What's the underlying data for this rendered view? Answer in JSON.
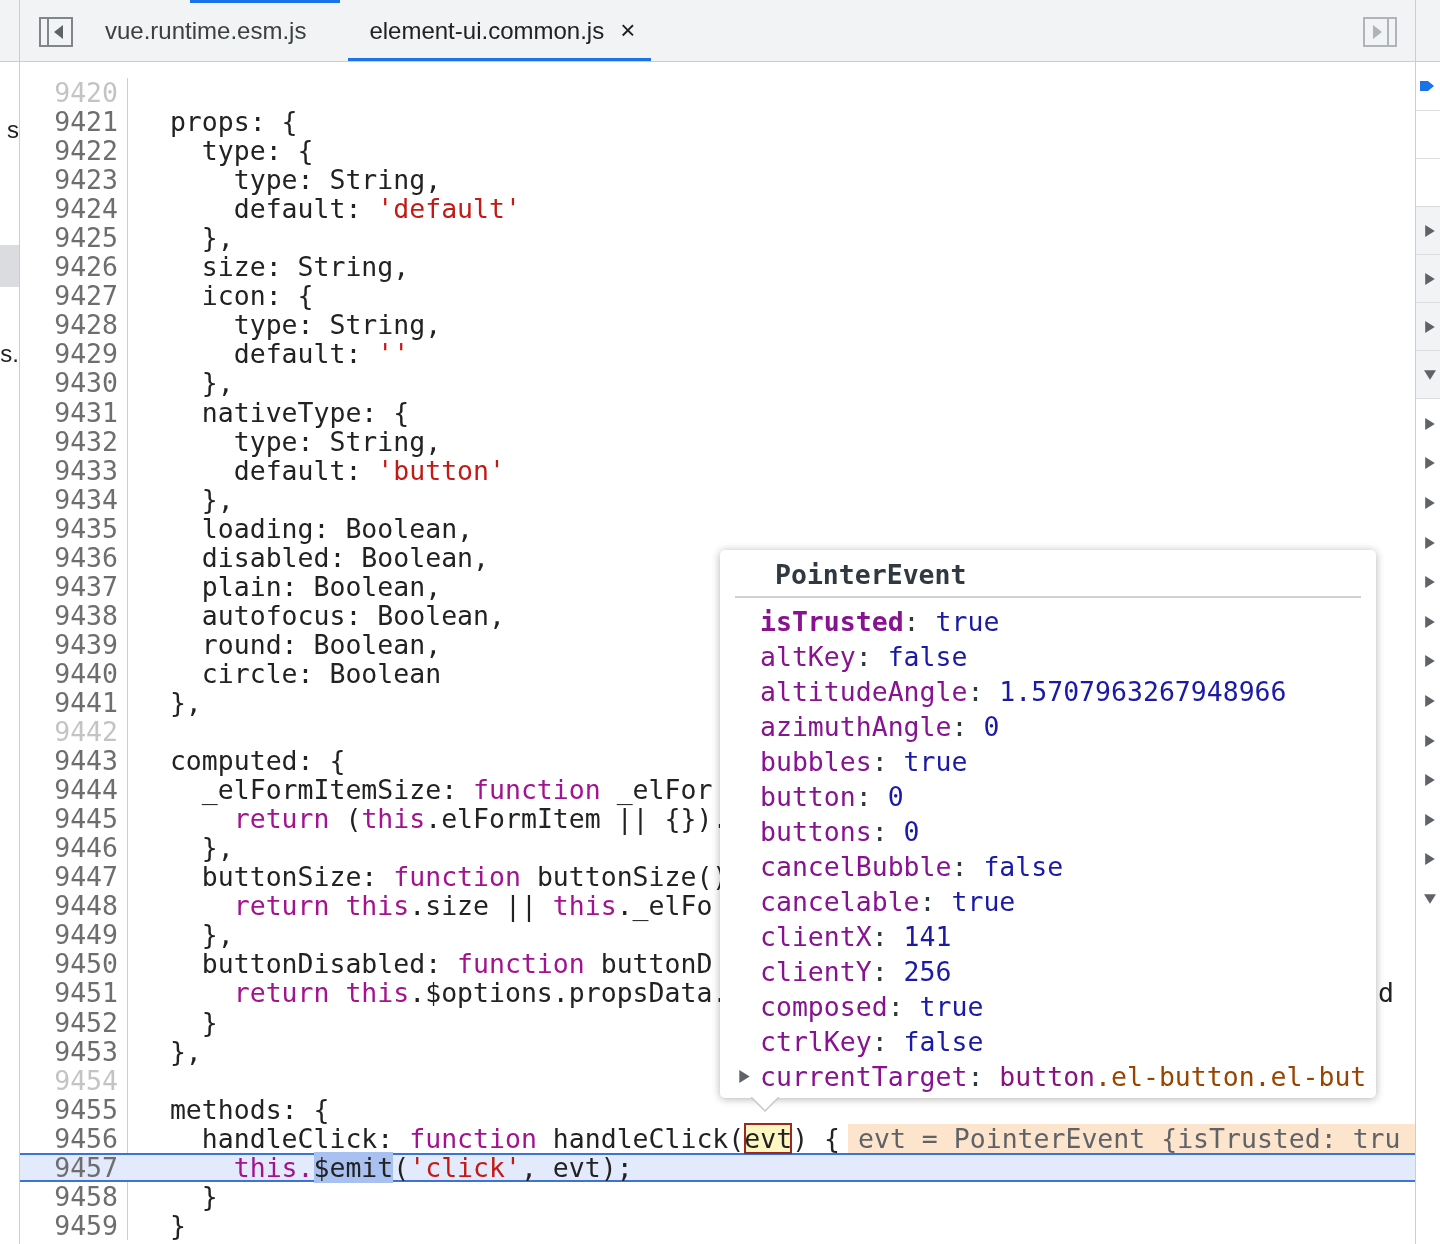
{
  "left_panel": {
    "items": [
      {
        "text": "s",
        "selected": false
      },
      {
        "selected": true
      },
      {
        "text": "s.",
        "selected": false
      }
    ]
  },
  "tabs": [
    {
      "label": "vue.runtime.esm.js",
      "selected": false
    },
    {
      "label": "element-ui.common.js",
      "selected": true,
      "close": "×"
    }
  ],
  "editor": {
    "lines": [
      {
        "number": "9420",
        "muted": true,
        "current": false
      },
      {
        "number": "9421",
        "muted": false,
        "current": false,
        "tokens": [
          {
            "text": "  props: {",
            "kind": "plain"
          }
        ]
      },
      {
        "number": "9422",
        "muted": false,
        "current": false,
        "tokens": [
          {
            "text": "    type: {",
            "kind": "plain"
          }
        ]
      },
      {
        "number": "9423",
        "muted": false,
        "current": false,
        "tokens": [
          {
            "text": "      type: String,",
            "kind": "plain"
          }
        ]
      },
      {
        "number": "9424",
        "muted": false,
        "current": false,
        "tokens": [
          {
            "text": "      default: ",
            "kind": "plain"
          },
          {
            "text": "'default'",
            "kind": "string"
          }
        ]
      },
      {
        "number": "9425",
        "muted": false,
        "current": false,
        "tokens": [
          {
            "text": "    },",
            "kind": "plain"
          }
        ]
      },
      {
        "number": "9426",
        "muted": false,
        "current": false,
        "tokens": [
          {
            "text": "    size: String,",
            "kind": "plain"
          }
        ]
      },
      {
        "number": "9427",
        "muted": false,
        "current": false,
        "tokens": [
          {
            "text": "    icon: {",
            "kind": "plain"
          }
        ]
      },
      {
        "number": "9428",
        "muted": false,
        "current": false,
        "tokens": [
          {
            "text": "      type: String,",
            "kind": "plain"
          }
        ]
      },
      {
        "number": "9429",
        "muted": false,
        "current": false,
        "tokens": [
          {
            "text": "      default: ",
            "kind": "plain"
          },
          {
            "text": "''",
            "kind": "string"
          }
        ]
      },
      {
        "number": "9430",
        "muted": false,
        "current": false,
        "tokens": [
          {
            "text": "    },",
            "kind": "plain"
          }
        ]
      },
      {
        "number": "9431",
        "muted": false,
        "current": false,
        "tokens": [
          {
            "text": "    nativeType: {",
            "kind": "plain"
          }
        ]
      },
      {
        "number": "9432",
        "muted": false,
        "current": false,
        "tokens": [
          {
            "text": "      type: String,",
            "kind": "plain"
          }
        ]
      },
      {
        "number": "9433",
        "muted": false,
        "current": false,
        "tokens": [
          {
            "text": "      default: ",
            "kind": "plain"
          },
          {
            "text": "'button'",
            "kind": "string"
          }
        ]
      },
      {
        "number": "9434",
        "muted": false,
        "current": false,
        "tokens": [
          {
            "text": "    },",
            "kind": "plain"
          }
        ]
      },
      {
        "number": "9435",
        "muted": false,
        "current": false,
        "tokens": [
          {
            "text": "    loading: Boolean,",
            "kind": "plain"
          }
        ]
      },
      {
        "number": "9436",
        "muted": false,
        "current": false,
        "tokens": [
          {
            "text": "    disabled: Boolean,",
            "kind": "plain"
          }
        ]
      },
      {
        "number": "9437",
        "muted": false,
        "current": false,
        "tokens": [
          {
            "text": "    plain: Boolean,",
            "kind": "plain"
          }
        ]
      },
      {
        "number": "9438",
        "muted": false,
        "current": false,
        "tokens": [
          {
            "text": "    autofocus: Boolean,",
            "kind": "plain"
          }
        ]
      },
      {
        "number": "9439",
        "muted": false,
        "current": false,
        "tokens": [
          {
            "text": "    round: Boolean,",
            "kind": "plain"
          }
        ]
      },
      {
        "number": "9440",
        "muted": false,
        "current": false,
        "tokens": [
          {
            "text": "    circle: Boolean",
            "kind": "plain"
          }
        ]
      },
      {
        "number": "9441",
        "muted": false,
        "current": false,
        "tokens": [
          {
            "text": "  },",
            "kind": "plain"
          }
        ]
      },
      {
        "number": "9442",
        "muted": true,
        "current": false
      },
      {
        "number": "9443",
        "muted": false,
        "current": false,
        "tokens": [
          {
            "text": "  computed: {",
            "kind": "plain"
          }
        ]
      },
      {
        "number": "9444",
        "muted": false,
        "current": false,
        "tokens": [
          {
            "text": "    _elFormItemSize: ",
            "kind": "plain"
          },
          {
            "text": "function",
            "kind": "keyword"
          },
          {
            "text": " _elFor",
            "kind": "plain"
          }
        ]
      },
      {
        "number": "9445",
        "muted": false,
        "current": false,
        "tokens": [
          {
            "text": "      return",
            "kind": "keyword"
          },
          {
            "text": " (",
            "kind": "plain"
          },
          {
            "text": "this",
            "kind": "keyword"
          },
          {
            "text": ".elFormItem || {}).",
            "kind": "plain"
          }
        ]
      },
      {
        "number": "9446",
        "muted": false,
        "current": false,
        "tokens": [
          {
            "text": "    },",
            "kind": "plain"
          }
        ]
      },
      {
        "number": "9447",
        "muted": false,
        "current": false,
        "tokens": [
          {
            "text": "    buttonSize: ",
            "kind": "plain"
          },
          {
            "text": "function",
            "kind": "keyword"
          },
          {
            "text": " buttonSize()",
            "kind": "plain"
          }
        ]
      },
      {
        "number": "9448",
        "muted": false,
        "current": false,
        "tokens": [
          {
            "text": "      return this",
            "kind": "keyword"
          },
          {
            "text": ".size || ",
            "kind": "plain"
          },
          {
            "text": "this",
            "kind": "keyword"
          },
          {
            "text": "._elFo",
            "kind": "plain"
          }
        ]
      },
      {
        "number": "9449",
        "muted": false,
        "current": false,
        "tokens": [
          {
            "text": "    },",
            "kind": "plain"
          }
        ]
      },
      {
        "number": "9450",
        "muted": false,
        "current": false,
        "tokens": [
          {
            "text": "    buttonDisabled: ",
            "kind": "plain"
          },
          {
            "text": "function",
            "kind": "keyword"
          },
          {
            "text": " buttonD",
            "kind": "plain"
          }
        ]
      },
      {
        "number": "9451",
        "muted": false,
        "current": false,
        "tokens": [
          {
            "text": "      return this",
            "kind": "keyword"
          },
          {
            "text": ".$options.propsData.",
            "kind": "plain"
          }
        ],
        "tail": "d"
      },
      {
        "number": "9452",
        "muted": false,
        "current": false,
        "tokens": [
          {
            "text": "    }",
            "kind": "plain"
          }
        ]
      },
      {
        "number": "9453",
        "muted": false,
        "current": false,
        "tokens": [
          {
            "text": "  },",
            "kind": "plain"
          }
        ]
      },
      {
        "number": "9454",
        "muted": true,
        "current": false
      },
      {
        "number": "9455",
        "muted": false,
        "current": false,
        "tokens": [
          {
            "text": "  methods: {",
            "kind": "plain"
          }
        ]
      },
      {
        "number": "9456",
        "muted": false,
        "current": false,
        "tokens": [
          {
            "text": "    handleClick: ",
            "kind": "plain"
          },
          {
            "text": "function",
            "kind": "keyword"
          },
          {
            "text": " handleClick(",
            "kind": "plain"
          },
          {
            "text": "evt",
            "kind": "hovered"
          },
          {
            "text": ") {",
            "kind": "plain"
          }
        ],
        "inline_value": "evt = PointerEvent {isTrusted: tru"
      },
      {
        "number": "9457",
        "muted": false,
        "current": true,
        "tokens": [
          {
            "text": "      this.",
            "kind": "keyword"
          },
          {
            "text": "$emit",
            "kind": "selected"
          },
          {
            "text": "(",
            "kind": "plain"
          },
          {
            "text": "'click'",
            "kind": "string"
          },
          {
            "text": ", evt);",
            "kind": "plain"
          }
        ]
      },
      {
        "number": "9458",
        "muted": false,
        "current": false,
        "tokens": [
          {
            "text": "    }",
            "kind": "plain"
          }
        ]
      },
      {
        "number": "9459",
        "muted": false,
        "current": false,
        "tokens": [
          {
            "text": "  }",
            "kind": "plain"
          }
        ]
      }
    ]
  },
  "popover": {
    "title": "PointerEvent",
    "properties": [
      {
        "key": "isTrusted",
        "separator": ":",
        "own": true,
        "expandable": false,
        "value": [
          {
            "text": "true",
            "kind": "literal"
          }
        ]
      },
      {
        "key": "altKey",
        "separator": ":",
        "own": false,
        "expandable": false,
        "value": [
          {
            "text": "false",
            "kind": "literal"
          }
        ]
      },
      {
        "key": "altitudeAngle",
        "separator": ":",
        "own": false,
        "expandable": false,
        "value": [
          {
            "text": "1.5707963267948966",
            "kind": "literal"
          }
        ]
      },
      {
        "key": "azimuthAngle",
        "separator": ":",
        "own": false,
        "expandable": false,
        "value": [
          {
            "text": "0",
            "kind": "literal"
          }
        ]
      },
      {
        "key": "bubbles",
        "separator": ":",
        "own": false,
        "expandable": false,
        "value": [
          {
            "text": "true",
            "kind": "literal"
          }
        ]
      },
      {
        "key": "button",
        "separator": ":",
        "own": false,
        "expandable": false,
        "value": [
          {
            "text": "0",
            "kind": "literal"
          }
        ]
      },
      {
        "key": "buttons",
        "separator": ":",
        "own": false,
        "expandable": false,
        "value": [
          {
            "text": "0",
            "kind": "literal"
          }
        ]
      },
      {
        "key": "cancelBubble",
        "separator": ":",
        "own": false,
        "expandable": false,
        "value": [
          {
            "text": "false",
            "kind": "literal"
          }
        ]
      },
      {
        "key": "cancelable",
        "separator": ":",
        "own": false,
        "expandable": false,
        "value": [
          {
            "text": "true",
            "kind": "literal"
          }
        ]
      },
      {
        "key": "clientX",
        "separator": ":",
        "own": false,
        "expandable": false,
        "value": [
          {
            "text": "141",
            "kind": "literal"
          }
        ]
      },
      {
        "key": "clientY",
        "separator": ":",
        "own": false,
        "expandable": false,
        "value": [
          {
            "text": "256",
            "kind": "literal"
          }
        ]
      },
      {
        "key": "composed",
        "separator": ":",
        "own": false,
        "expandable": false,
        "value": [
          {
            "text": "true",
            "kind": "literal"
          }
        ]
      },
      {
        "key": "ctrlKey",
        "separator": ":",
        "own": false,
        "expandable": false,
        "value": [
          {
            "text": "false",
            "kind": "literal"
          }
        ]
      },
      {
        "key": "currentTarget",
        "separator": ":",
        "own": false,
        "expandable": true,
        "value": [
          {
            "text": "button",
            "kind": "tag"
          },
          {
            "text": ".el-button.el-but",
            "kind": "class"
          }
        ]
      }
    ]
  },
  "right_panel": {
    "sections": [
      {
        "expanded": false
      },
      {
        "expanded": false
      },
      {
        "expanded": false
      },
      {
        "expanded": true
      }
    ],
    "scope_items": [
      {
        "expanded": false
      },
      {
        "expanded": false
      },
      {
        "expanded": false
      },
      {
        "expanded": false
      },
      {
        "expanded": false
      },
      {
        "expanded": false
      },
      {
        "expanded": false
      },
      {
        "expanded": false
      },
      {
        "expanded": false
      },
      {
        "expanded": false
      },
      {
        "expanded": false
      },
      {
        "expanded": false
      },
      {
        "expanded": true
      }
    ]
  }
}
